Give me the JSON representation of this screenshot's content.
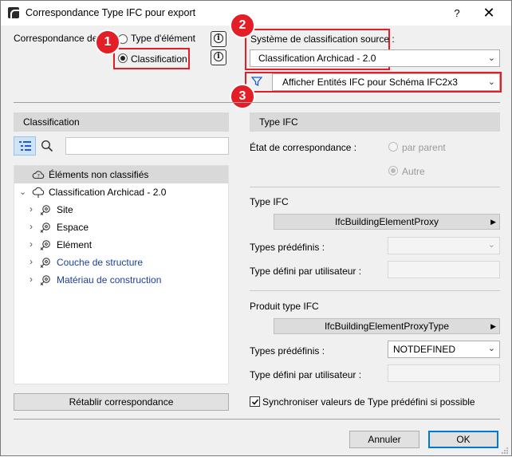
{
  "window": {
    "title": "Correspondance Type IFC pour export",
    "help_label": "?",
    "close_label": "✕"
  },
  "mapping": {
    "label": "Correspondance des",
    "option_type": "Type d'élément",
    "option_classification": "Classification",
    "selected": "Classification"
  },
  "source_system": {
    "label": "Système de classification source :",
    "value": "Classification Archicad - 2.0"
  },
  "filter": {
    "value": "Afficher Entités IFC pour Schéma IFC2x3"
  },
  "badges": [
    "1",
    "2",
    "3"
  ],
  "left_panel": {
    "header": "Classification",
    "search_value": "",
    "unclassified": "Éléments non classifiés",
    "root": "Classification Archicad - 2.0",
    "items": [
      {
        "label": "Site",
        "style": "normal"
      },
      {
        "label": "Espace",
        "style": "normal"
      },
      {
        "label": "Elément",
        "style": "normal"
      },
      {
        "label": "Couche de structure",
        "style": "blue"
      },
      {
        "label": "Matériau de construction",
        "style": "blue"
      }
    ],
    "reset_button": "Rétablir correspondance"
  },
  "right_panel": {
    "header": "Type IFC",
    "state_label": "État de correspondance :",
    "state_option_parent": "par parent",
    "state_option_other": "Autre",
    "ifc_type_label": "Type IFC",
    "ifc_type_value": "IfcBuildingElementProxy",
    "predefined_label_1": "Types prédéfinis :",
    "predefined_value_1": "",
    "user_type_label_1": "Type défini par utilisateur :",
    "user_type_value_1": "",
    "product_type_label": "Produit type IFC",
    "product_type_value": "IfcBuildingElementProxyType",
    "predefined_label_2": "Types prédéfinis :",
    "predefined_value_2": "NOTDEFINED",
    "user_type_label_2": "Type défini par utilisateur :",
    "user_type_value_2": "",
    "sync_label": "Synchroniser valeurs de Type prédéfini si possible",
    "sync_checked": true
  },
  "footer": {
    "cancel_label": "Annuler",
    "ok_label": "OK"
  },
  "colors": {
    "callout_red": "#e41e26",
    "link_blue": "#1a3fa0",
    "ok_border": "#0078d7"
  }
}
